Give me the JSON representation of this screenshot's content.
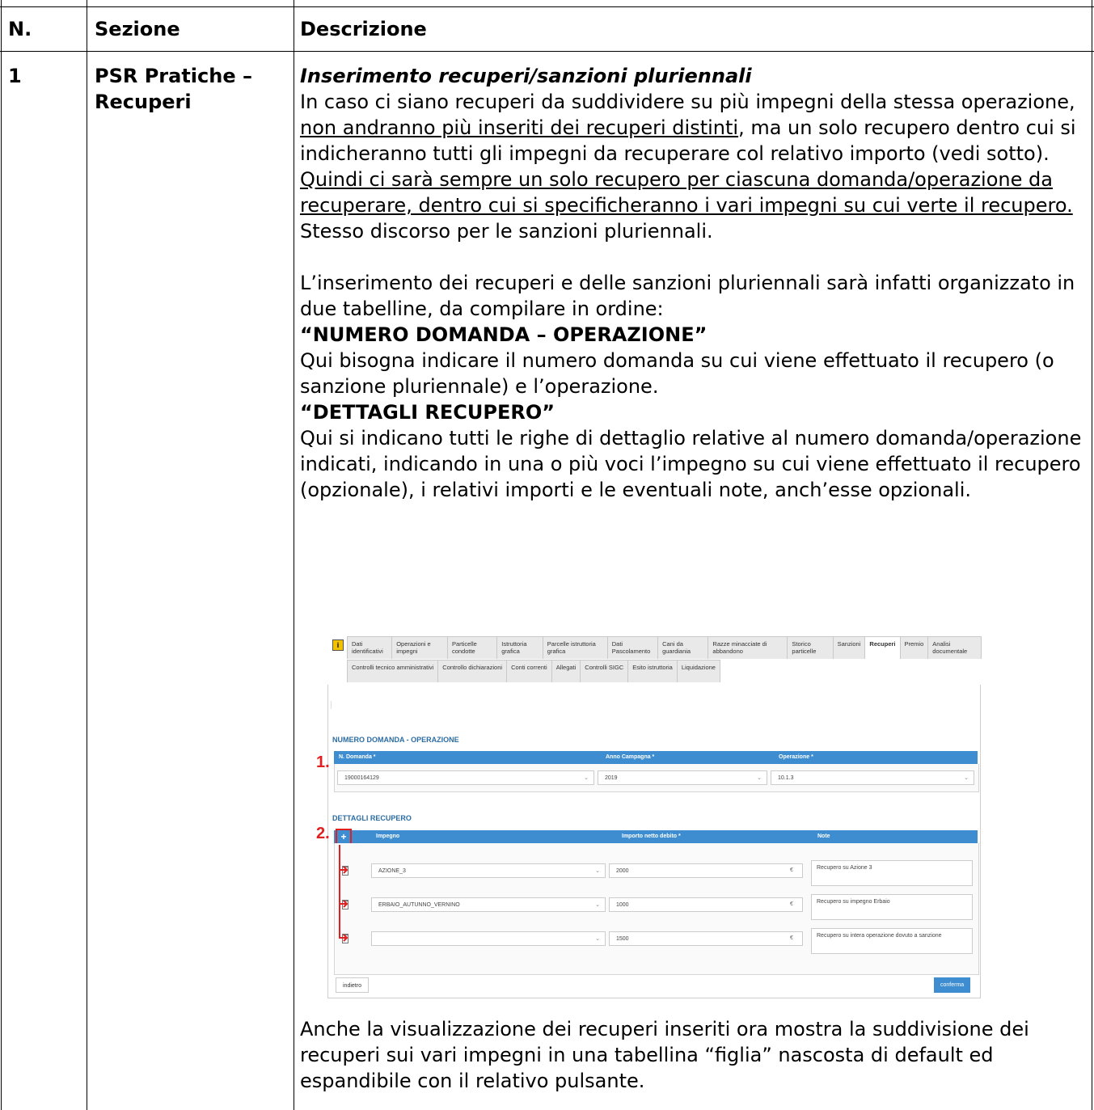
{
  "table": {
    "header": {
      "n": "N.",
      "sezione": "Sezione",
      "descrizione": "Descrizione"
    },
    "row": {
      "n": "1",
      "sezione_line1": "PSR Pratiche –",
      "sezione_line2": "Recuperi"
    }
  },
  "description": {
    "title": "Inserimento recuperi/sanzioni pluriennali",
    "p1_a": "In caso ci siano recuperi da suddividere su più impegni della stessa operazione, ",
    "p1_u": "non andranno più inseriti dei recuperi distinti",
    "p1_b": ", ma un solo recupero dentro cui si indicheranno tutti gli impegni da recuperare col relativo importo (vedi sotto).",
    "p2_u": "Quindi ci sarà sempre un solo recupero per ciascuna domanda/operazione da recuperare, dentro cui si specificheranno i vari impegni su cui verte il recupero.",
    "p3": "Stesso discorso per le sanzioni pluriennali.",
    "p4": "L’inserimento dei recuperi e delle sanzioni pluriennali sarà infatti organizzato in due tabelline, da compilare in ordine:",
    "h1": "“NUMERO DOMANDA – OPERAZIONE”",
    "p5": "Qui bisogna indicare il numero domanda su cui viene effettuato il recupero (o sanzione pluriennale) e l’operazione.",
    "h2": "“DETTAGLI RECUPERO”",
    "p6": "Qui si indicano tutti le righe di dettaglio relative al numero domanda/operazione indicati, indicando in una o più voci l’impegno su cui viene effettuato il recupero (opzionale), i relativi importi e le eventuali note, anch’esse opzionali.",
    "p7": "Anche la visualizzazione dei recuperi inseriti ora mostra la suddivisione dei recuperi sui vari impegni in una tabellina “figlia” nascosta di default ed espandibile con il relativo pulsante."
  },
  "screenshot": {
    "tabs_row1": [
      "Dati identificativi",
      "Operazioni e impegni",
      "Particelle condotte",
      "Istruttoria grafica",
      "Parcelle istruttoria grafica",
      "Dati Pascolamento",
      "Cani da guardiania",
      "Razze minacciate di abbandono",
      "Storico particelle",
      "Sanzioni",
      "Recuperi",
      "Premio",
      "Analisi documentale"
    ],
    "tabs_row2": [
      "Controlli tecnico amministrativi",
      "Controllo dichiarazioni",
      "Conti correnti",
      "Allegati",
      "Controlli SIGC",
      "Esito istruttoria",
      "Liquidazione"
    ],
    "active_tab": "Recuperi",
    "section1": {
      "title": "NUMERO DOMANDA - OPERAZIONE",
      "marker": "1.",
      "col_domanda": "N. Domanda *",
      "col_anno": "Anno Campagna *",
      "col_operazione": "Operazione *",
      "domanda": "19000164129",
      "anno": "2019",
      "operazione": "10.1.3"
    },
    "section2": {
      "title": "DETTAGLI RECUPERO",
      "marker": "2.",
      "col_impegno": "Impegno",
      "col_importo": "Importo netto debito *",
      "col_note": "Note",
      "rows": [
        {
          "impegno": "AZIONE_3",
          "importo": "2000",
          "note": "Recupero su Azione 3"
        },
        {
          "impegno": "ERBAIO_AUTUNNO_VERNINO",
          "importo": "1000",
          "note": "Recupero su impegno Erbaio"
        },
        {
          "impegno": "",
          "importo": "1500",
          "note": "Recupero su intera operazione dovuto a sanzione"
        }
      ],
      "currency": "€"
    },
    "btn_back": "indietro",
    "btn_confirm": "conferma",
    "accent_color": "#3e8dd0",
    "marker_color": "#e02020"
  }
}
